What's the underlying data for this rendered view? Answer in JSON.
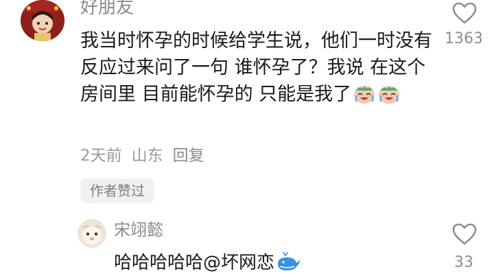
{
  "main_comment": {
    "username": "好朋友",
    "text": "我当时怀孕的时候给学生说，他们一时没有反应过来问了一句 谁怀孕了？我说 在这个房间里 目前能怀孕的 只能是我了",
    "emojis": [
      "crying-laughing-emoji",
      "crying-laughing-emoji"
    ],
    "time": "2天前",
    "location": "山东",
    "reply_label": "回复",
    "author_liked_label": "作者赞过",
    "like_count": "1363"
  },
  "reply_comment": {
    "username": "宋翊懿",
    "text": "哈哈哈哈哈",
    "mention": "@坏网恋",
    "mention_icon": "whale-icon",
    "like_count": "33"
  },
  "colors": {
    "username": "#8a8a8a",
    "body": "#1a1a1a",
    "meta": "#9a9a9a",
    "tag_bg": "#f1f1f1"
  }
}
